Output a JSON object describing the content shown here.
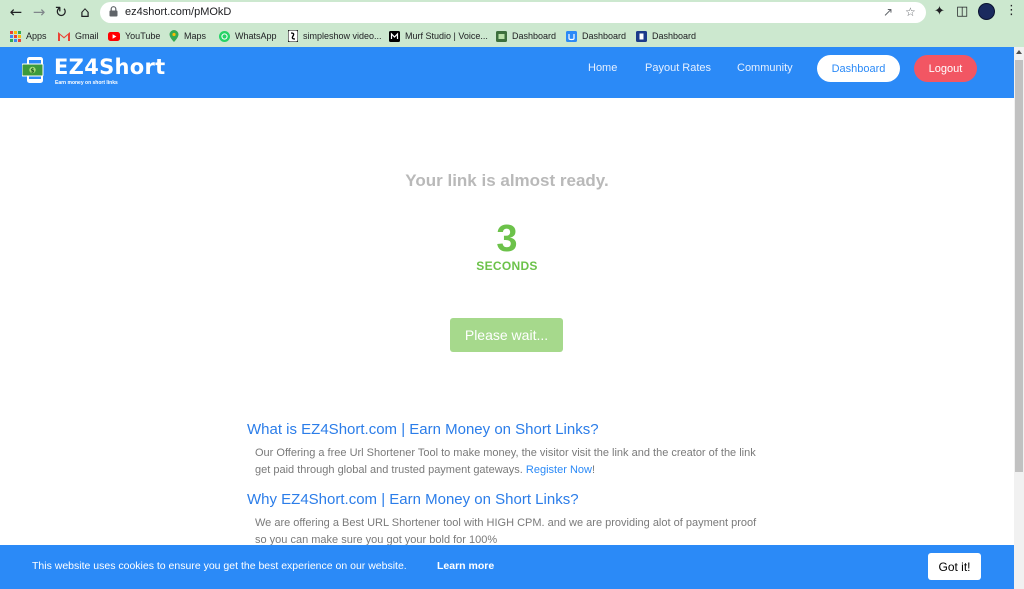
{
  "browser": {
    "url": "ez4short.com/pMOkD",
    "bookmarks": [
      {
        "label": "Apps",
        "icon": "apps-grid-icon",
        "color": "#ea4335"
      },
      {
        "label": "Gmail",
        "icon": "gmail-icon",
        "color": "#ea4335"
      },
      {
        "label": "YouTube",
        "icon": "youtube-icon",
        "color": "#ff0000"
      },
      {
        "label": "Maps",
        "icon": "maps-icon",
        "color": "#34a853"
      },
      {
        "label": "WhatsApp",
        "icon": "whatsapp-icon",
        "color": "#25d366"
      },
      {
        "label": "simpleshow video...",
        "icon": "simpleshow-icon",
        "color": "#000000"
      },
      {
        "label": "Murf Studio | Voice...",
        "icon": "murf-icon",
        "color": "#000000"
      },
      {
        "label": "Dashboard",
        "icon": "dashboard-icon",
        "color": "#3c6f3c"
      },
      {
        "label": "Dashboard",
        "icon": "dashboard-icon",
        "color": "#2b8af7"
      },
      {
        "label": "Dashboard",
        "icon": "dashboard-icon",
        "color": "#1a3a8a"
      }
    ]
  },
  "site": {
    "logo_prefix": "E",
    "logo_z": "Z",
    "logo_suffix": "4Short",
    "tagline": "Earn money on short links",
    "nav": [
      "Home",
      "Payout Rates",
      "Community"
    ],
    "dashboard_label": "Dashboard",
    "logout_label": "Logout",
    "colors": {
      "header": "#2b8af7",
      "logout": "#f25663",
      "accent_green": "#6cc24a"
    }
  },
  "main": {
    "almost_ready": "Your link is almost ready.",
    "countdown": "3",
    "seconds_label": "SECONDS",
    "wait_button": "Please wait..."
  },
  "sections": [
    {
      "heading": "What is EZ4Short.com | Earn Money on Short Links?",
      "text": "Our Offering a free Url Shortener Tool to make money, the visitor visit the link and the creator of the link get paid through global and trusted payment gateways.",
      "link": "Register Now",
      "trailing": "!"
    },
    {
      "heading": "Why EZ4Short.com | Earn Money on Short Links?",
      "text": "We are offering a Best URL Shortener tool with HIGH CPM. and we are providing alot of payment proof so you can make sure you got your bold for 100%"
    }
  ],
  "cookie": {
    "text": "This website uses cookies to ensure you get the best experience on our website.",
    "more": "Learn more",
    "button": "Got it!"
  }
}
